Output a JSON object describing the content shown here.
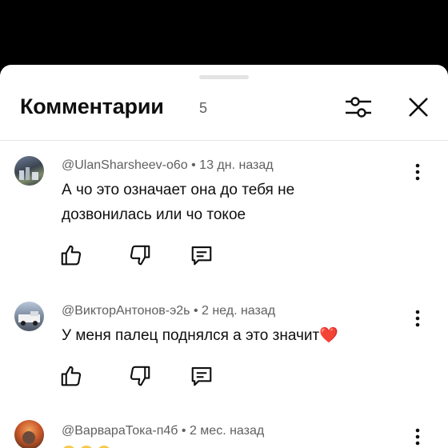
{
  "header": {
    "title": "Комментарии",
    "count": "5"
  },
  "comments": [
    {
      "author": "@UlanSharsheev-o6o",
      "time": "13 дн. назад",
      "line1": "А чо это означает она до тебя не",
      "line2": "дозвонилась или чо токое"
    },
    {
      "author": "@ВикторАнтонов-э2ь",
      "time": "2 нед. назад",
      "line1": "У меня палец поднялся а это значит❤️",
      "line2": ""
    },
    {
      "author": "@ВарвараТока-п4б",
      "time": "2 мес. назад",
      "line1": "",
      "line2": ""
    }
  ],
  "separator": " • ",
  "colors": {
    "text": "#0f0f0f",
    "secondary": "#606060",
    "background": "#ffffff",
    "overlay": "#000000"
  },
  "icons": [
    "filter-icon",
    "close-icon",
    "more-vert-icon",
    "thumb-up-icon",
    "thumb-down-icon",
    "reply-icon"
  ]
}
